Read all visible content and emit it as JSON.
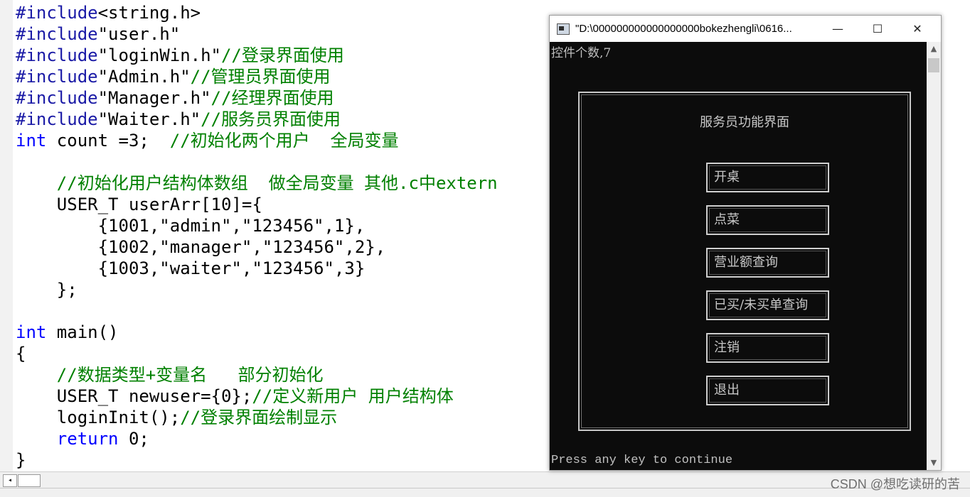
{
  "editor": {
    "lines": [
      [
        {
          "t": "#include",
          "c": "pp"
        },
        {
          "t": "<string.h>",
          "c": "str"
        }
      ],
      [
        {
          "t": "#include",
          "c": "pp"
        },
        {
          "t": "\"user.h\"",
          "c": "str"
        }
      ],
      [
        {
          "t": "#include",
          "c": "pp"
        },
        {
          "t": "\"loginWin.h\"",
          "c": "str"
        },
        {
          "t": "//登录界面使用",
          "c": "cm"
        }
      ],
      [
        {
          "t": "#include",
          "c": "pp"
        },
        {
          "t": "\"Admin.h\"",
          "c": "str"
        },
        {
          "t": "//管理员界面使用",
          "c": "cm"
        }
      ],
      [
        {
          "t": "#include",
          "c": "pp"
        },
        {
          "t": "\"Manager.h\"",
          "c": "str"
        },
        {
          "t": "//经理界面使用",
          "c": "cm"
        }
      ],
      [
        {
          "t": "#include",
          "c": "pp"
        },
        {
          "t": "\"Waiter.h\"",
          "c": "str"
        },
        {
          "t": "//服务员界面使用",
          "c": "cm"
        }
      ],
      [
        {
          "t": "int",
          "c": "kw"
        },
        {
          "t": " count =3;  ",
          "c": "str"
        },
        {
          "t": "//初始化两个用户  全局变量",
          "c": "cm"
        }
      ],
      [],
      [
        {
          "t": "    ",
          "c": "str"
        },
        {
          "t": "//初始化用户结构体数组  做全局变量 其他.c中extern",
          "c": "cm"
        }
      ],
      [
        {
          "t": "    USER_T userArr[10]={",
          "c": "str"
        }
      ],
      [
        {
          "t": "        {1001,\"admin\",\"123456\",1},",
          "c": "str"
        }
      ],
      [
        {
          "t": "        {1002,\"manager\",\"123456\",2},",
          "c": "str"
        }
      ],
      [
        {
          "t": "        {1003,\"waiter\",\"123456\",3}",
          "c": "str"
        }
      ],
      [
        {
          "t": "    };",
          "c": "str"
        }
      ],
      [],
      [
        {
          "t": "int",
          "c": "kw"
        },
        {
          "t": " main()",
          "c": "str"
        }
      ],
      [
        {
          "t": "{",
          "c": "str"
        }
      ],
      [
        {
          "t": "    ",
          "c": "str"
        },
        {
          "t": "//数据类型+变量名   部分初始化",
          "c": "cm"
        }
      ],
      [
        {
          "t": "    USER_T newuser={0};",
          "c": "str"
        },
        {
          "t": "//定义新用户 用户结构体",
          "c": "cm"
        }
      ],
      [
        {
          "t": "    loginInit();",
          "c": "str"
        },
        {
          "t": "//登录界面绘制显示",
          "c": "cm"
        }
      ],
      [
        {
          "t": "    ",
          "c": "str"
        },
        {
          "t": "return",
          "c": "kw"
        },
        {
          "t": " 0;",
          "c": "str"
        }
      ],
      [
        {
          "t": "}",
          "c": "str"
        }
      ]
    ]
  },
  "scrollbar": {
    "left_arrow": "◂"
  },
  "console": {
    "title": "\"D:\\000000000000000000bokezhengli\\0616...",
    "controls": {
      "minimize": "—",
      "maximize": "☐",
      "close": "✕"
    },
    "control_count": "控件个数,7",
    "panel_title": "服务员功能界面",
    "buttons": [
      "开桌",
      "点菜",
      "营业额查询",
      "已买/未买单查询",
      "注销",
      "退出"
    ],
    "press_key": "Press any key to continue",
    "scroll_up": "▲",
    "scroll_down": "▼"
  },
  "watermark": "CSDN @想吃读研的苦"
}
